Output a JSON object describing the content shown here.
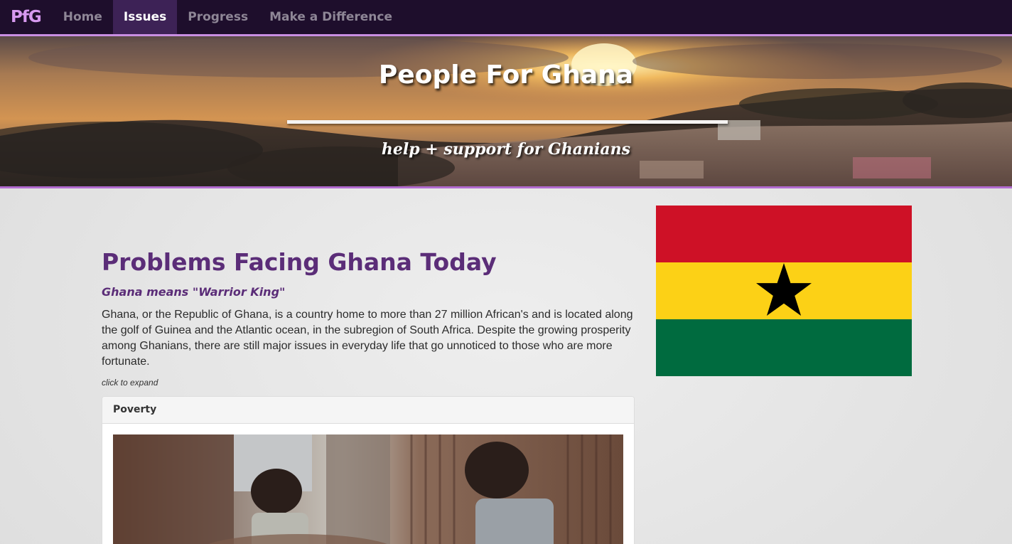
{
  "navbar": {
    "brand": "PfG",
    "items": [
      {
        "label": "Home",
        "active": false
      },
      {
        "label": "Issues",
        "active": true
      },
      {
        "label": "Progress",
        "active": false
      },
      {
        "label": "Make a Difference",
        "active": false
      }
    ],
    "colors": {
      "background": "#1e0e2c",
      "active_bg": "#3d2256",
      "accent": "#c98fe3"
    }
  },
  "hero": {
    "title": "People For Ghana",
    "tagline": "help + support for Ghanians"
  },
  "main": {
    "title": "Problems Facing Ghana Today",
    "subtitle": "Ghana means \"Warrior King\"",
    "paragraph": "Ghana, or the Republic of Ghana, is a country home to more than 27 million African's and is located along the golf of Guinea and the Atlantic ocean, in the subregion of South Africa. Despite the growing prosperity among Ghanians, there are still major issues in everyday life that go unnoticed to those who are more fortunate.",
    "hint": "click to expand",
    "accent_color": "#5b2d78",
    "panels": [
      {
        "heading": "Poverty"
      }
    ]
  },
  "flag": {
    "colors": {
      "red": "#ce1126",
      "yellow": "#fcd116",
      "green": "#006b3f",
      "star": "#000000"
    }
  }
}
